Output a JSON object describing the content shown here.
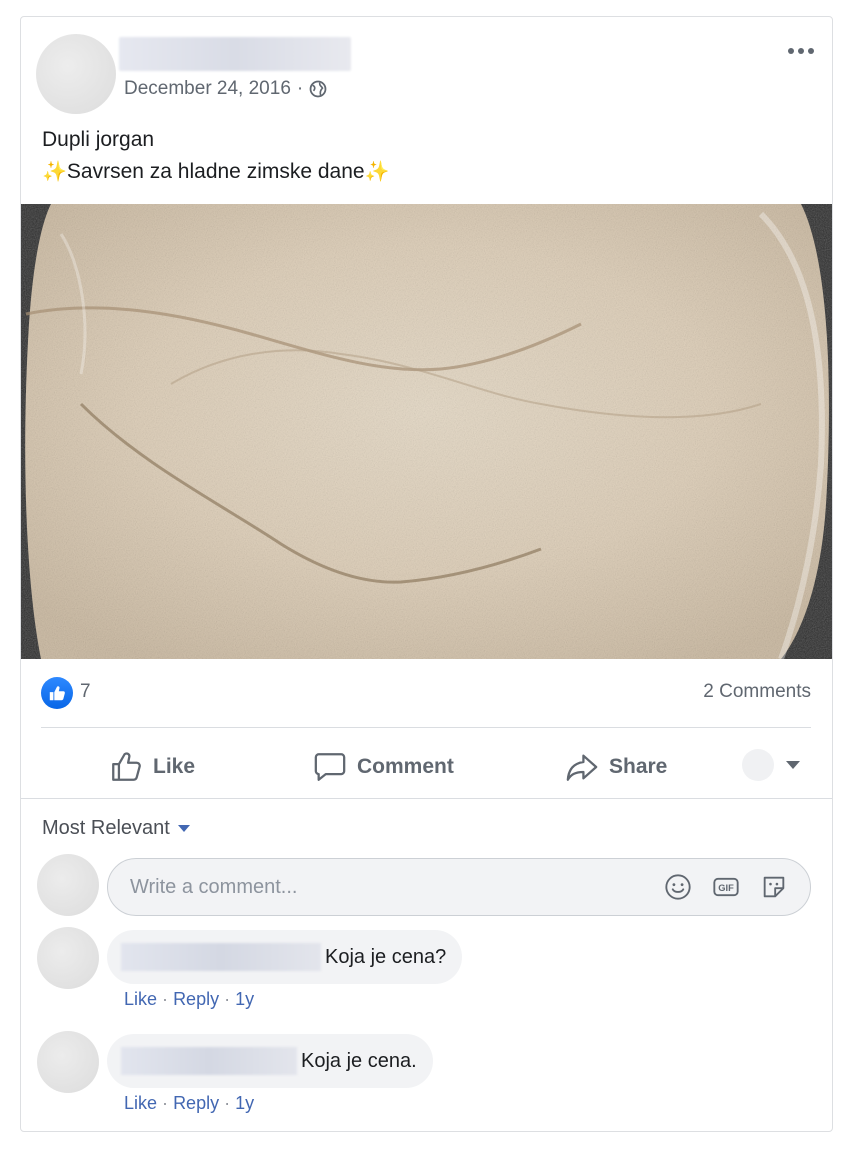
{
  "post": {
    "date": "December 24, 2016",
    "date_sep": "·",
    "text_line1": "Dupli jorgan",
    "sparkle": "✨",
    "text_line2": "Savrsen za hladne zimske dane"
  },
  "reactions": {
    "like_count": "7",
    "comments_count": "2 Comments"
  },
  "actions": {
    "like": "Like",
    "comment": "Comment",
    "share": "Share"
  },
  "comments_section": {
    "sort_label": "Most Relevant",
    "composer_placeholder": "Write a comment...",
    "composer_icons": [
      "emoji-icon",
      "gif-icon",
      "sticker-icon"
    ],
    "items": [
      {
        "text": "Koja je cena?",
        "like": "Like",
        "sep": "·",
        "reply": "Reply",
        "age": "1y"
      },
      {
        "text": "Koja je cena.",
        "like": "Like",
        "sep": "·",
        "reply": "Reply",
        "age": "1y"
      }
    ]
  },
  "colors": {
    "link_blue": "#4267b2",
    "like_blue": "#1877f2",
    "muted_text": "#606770",
    "border": "#dddfe2"
  }
}
